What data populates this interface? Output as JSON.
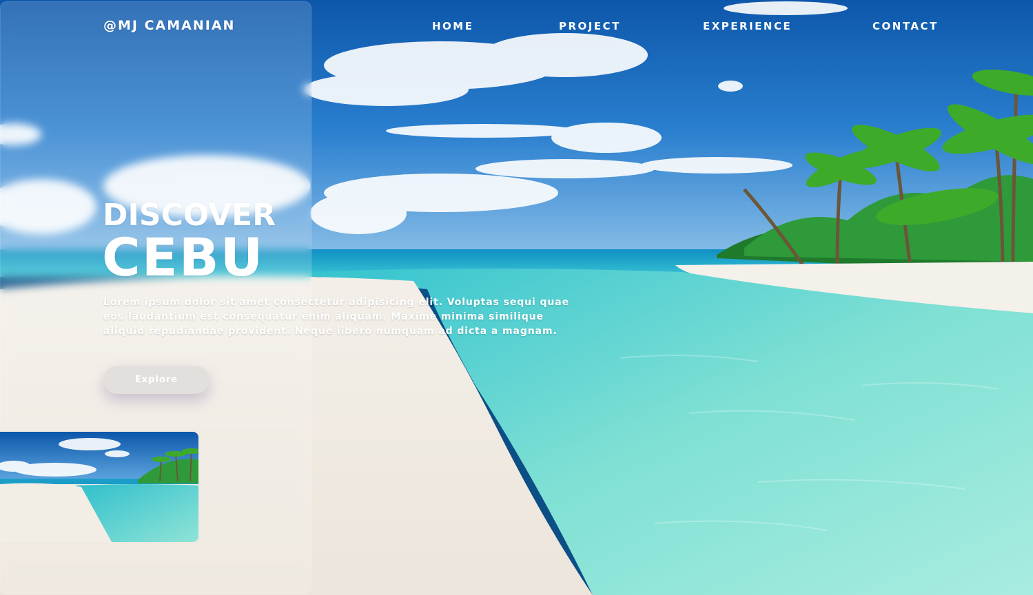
{
  "header": {
    "brand": "@MJ CAMANIAN"
  },
  "nav": {
    "items": [
      {
        "label": "HOME"
      },
      {
        "label": "PROJECT"
      },
      {
        "label": "EXPERIENCE"
      },
      {
        "label": "CONTACT"
      }
    ]
  },
  "hero": {
    "title_small": "DISCOVER",
    "title_large": "CEBU",
    "description": "Lorem ipsum dolor sit amet consectetur adipisicing elit. Voluptas sequi quae eos laudantium est consequatur enim aliquam. Maxime minima similique aliquid repudiandae provident. Neque libero numquam ad dicta a magnam.",
    "cta_label": "Explore"
  },
  "colors": {
    "text": "#ffffff",
    "button_bg": "#e2dfdc",
    "sky": "#1565b5",
    "sea": "#5fd6c8",
    "sand": "#f1ece4"
  }
}
